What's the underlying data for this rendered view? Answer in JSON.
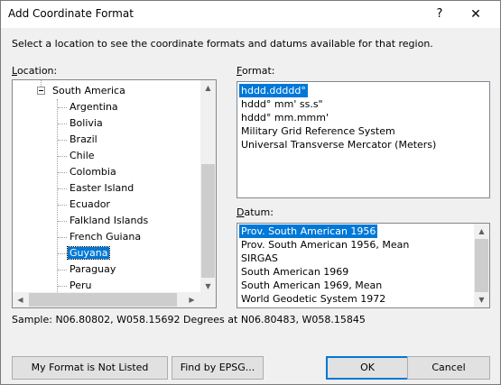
{
  "window": {
    "title": "Add Coordinate Format",
    "help_glyph": "?",
    "close_glyph": "✕"
  },
  "instructions": "Select a location to see the coordinate formats and datums available for that region.",
  "location": {
    "label_accel": "L",
    "label_rest": "ocation:",
    "parent": "South America",
    "items": [
      "Argentina",
      "Bolivia",
      "Brazil",
      "Chile",
      "Colombia",
      "Easter Island",
      "Ecuador",
      "Falkland Islands",
      "French Guiana",
      "Guyana",
      "Paraguay",
      "Peru"
    ],
    "selected": "Guyana"
  },
  "format": {
    "label_accel": "F",
    "label_rest": "ormat:",
    "items": [
      "hddd.ddddd°",
      "hddd° mm' ss.s\"",
      "hddd° mm.mmm'",
      "Military Grid Reference System",
      "Universal Transverse Mercator (Meters)"
    ],
    "selected": "hddd.ddddd°"
  },
  "datum": {
    "label_accel": "D",
    "label_rest": "atum:",
    "items": [
      "Prov. South American 1956",
      "Prov. South American 1956, Mean",
      "SIRGAS",
      "South American 1969",
      "South American 1969, Mean",
      "World Geodetic System 1972"
    ],
    "selected": "Prov. South American 1956"
  },
  "sample": "Sample: N06.80802, W058.15692 Degrees at N06.80483, W058.15845",
  "buttons": {
    "not_listed": "My Format is Not Listed",
    "find_epsg": "Find by EPSG...",
    "ok": "OK",
    "cancel": "Cancel"
  },
  "icons": {
    "scroll_up": "▲",
    "scroll_down": "▼",
    "scroll_left": "◀",
    "scroll_right": "▶"
  }
}
